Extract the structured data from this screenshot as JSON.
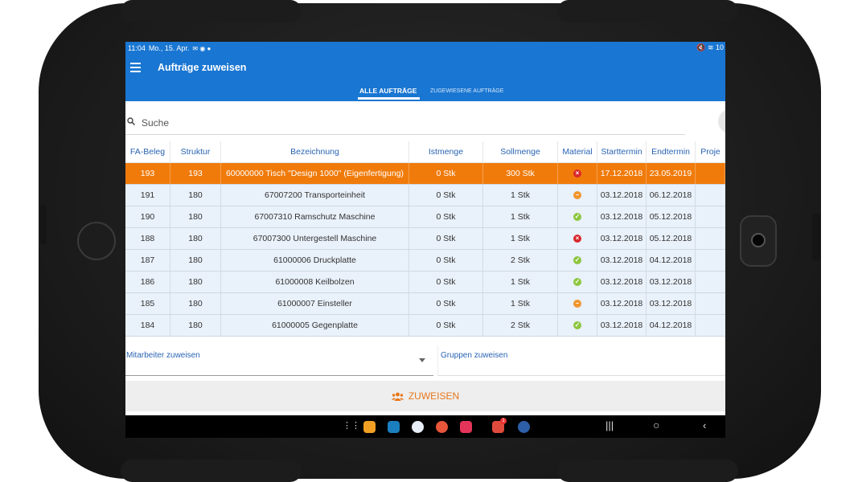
{
  "status_bar": {
    "time": "11:04",
    "date": "Mo., 15. Apr.",
    "right": "10"
  },
  "app": {
    "title": "Aufträge zuweisen"
  },
  "tabs": [
    {
      "label": "ALLE AUFTRÄGE",
      "active": true
    },
    {
      "label": "ZUGEWIESENE AUFTRÄGE",
      "active": false
    }
  ],
  "search": {
    "placeholder": "Suche"
  },
  "table": {
    "columns": [
      "FA-Beleg",
      "Struktur",
      "Bezeichnung",
      "Istmenge",
      "Sollmenge",
      "Material",
      "Starttermin",
      "Endtermin",
      "Proje"
    ],
    "rows": [
      {
        "beleg": "193",
        "struktur": "193",
        "bezeichnung": "60000000 Tisch \"Design 1000\" (Eigenfertigung)",
        "ist": "0 Stk",
        "soll": "300 Stk",
        "material": "red",
        "start": "17.12.2018",
        "end": "23.05.2019",
        "selected": true
      },
      {
        "beleg": "191",
        "struktur": "180",
        "bezeichnung": "67007200 Transporteinheit",
        "ist": "0 Stk",
        "soll": "1 Stk",
        "material": "orange",
        "start": "03.12.2018",
        "end": "06.12.2018"
      },
      {
        "beleg": "190",
        "struktur": "180",
        "bezeichnung": "67007310 Ramschutz Maschine",
        "ist": "0 Stk",
        "soll": "1 Stk",
        "material": "green",
        "start": "03.12.2018",
        "end": "05.12.2018"
      },
      {
        "beleg": "188",
        "struktur": "180",
        "bezeichnung": "67007300 Untergestell Maschine",
        "ist": "0 Stk",
        "soll": "1 Stk",
        "material": "red",
        "start": "03.12.2018",
        "end": "05.12.2018"
      },
      {
        "beleg": "187",
        "struktur": "180",
        "bezeichnung": "61000006 Druckplatte",
        "ist": "0 Stk",
        "soll": "2 Stk",
        "material": "green",
        "start": "03.12.2018",
        "end": "04.12.2018"
      },
      {
        "beleg": "186",
        "struktur": "180",
        "bezeichnung": "61000008 Keilbolzen",
        "ist": "0 Stk",
        "soll": "1 Stk",
        "material": "green",
        "start": "03.12.2018",
        "end": "03.12.2018"
      },
      {
        "beleg": "185",
        "struktur": "180",
        "bezeichnung": "61000007 Einsteller",
        "ist": "0 Stk",
        "soll": "1 Stk",
        "material": "orange",
        "start": "03.12.2018",
        "end": "03.12.2018"
      },
      {
        "beleg": "184",
        "struktur": "180",
        "bezeichnung": "61000005 Gegenplatte",
        "ist": "0 Stk",
        "soll": "2 Stk",
        "material": "green",
        "start": "03.12.2018",
        "end": "04.12.2018"
      }
    ]
  },
  "assign": {
    "employee_label": "Mitarbeiter zuweisen",
    "group_label": "Gruppen zuweisen",
    "button_label": "ZUWEISEN"
  },
  "colors": {
    "primary": "#1976d2",
    "selected_row": "#f07b0b",
    "row_bg": "#e9f1fa",
    "accent": "#e8761a",
    "status_red": "#d9262c",
    "status_orange": "#f0962e",
    "status_green": "#8cc63f"
  },
  "nav": {
    "badge": "1"
  }
}
